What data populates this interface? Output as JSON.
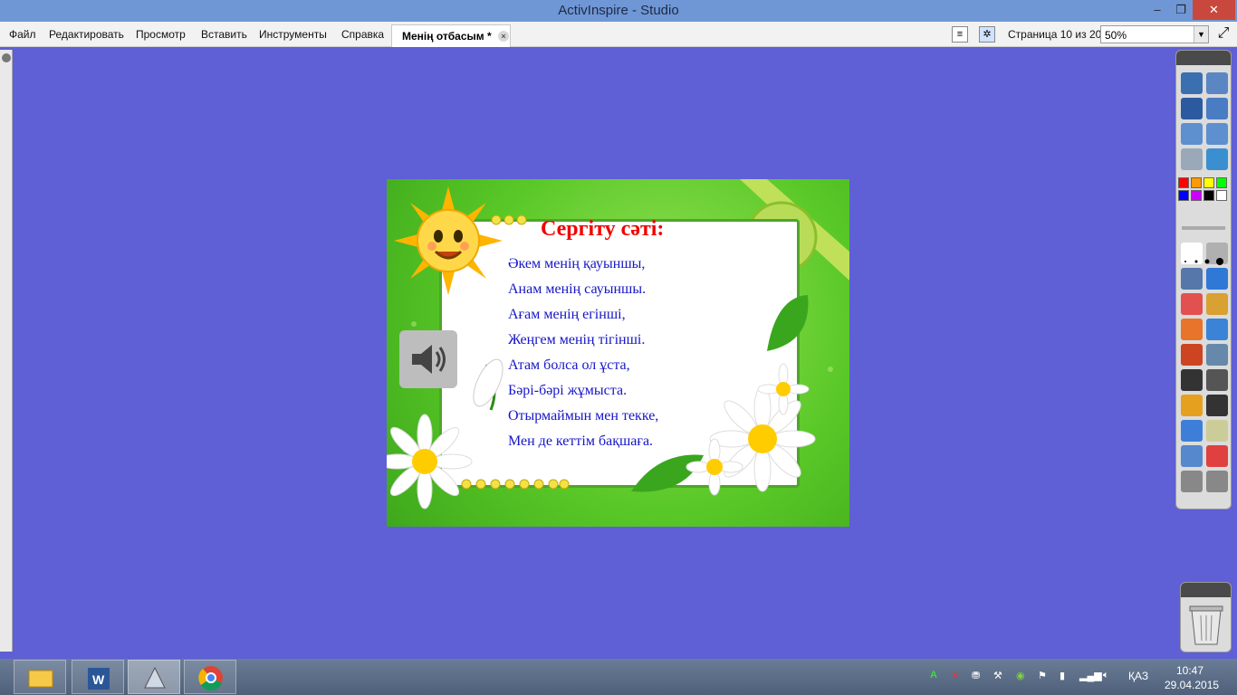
{
  "window": {
    "title": "ActivInspire - Studio",
    "min": "–",
    "max": "❐",
    "close": "✕"
  },
  "menu": [
    "Файл",
    "Редактировать",
    "Просмотр",
    "Вставить",
    "Инструменты",
    "Справка"
  ],
  "document_tab": {
    "label": "Менің отбасым *",
    "close": "×"
  },
  "page_indicator": "Страница 10 из 20",
  "zoom": {
    "value": "50%"
  },
  "slide": {
    "title": "Сергіту сәті:",
    "lines": [
      "Әкем менің қауыншы,",
      "Анам менің сауыншы.",
      "Ағам менің егінші,",
      "Жеңгем менің тігінші.",
      "Атам болса ол ұста,",
      "Бәрі-бәрі жұмыста.",
      "Отырмаймын мен текке,",
      "Мен де кеттім бақшаға."
    ],
    "background_color": "#59c827",
    "title_color": "#f20000",
    "text_color": "#1616c8"
  },
  "palette": [
    "#ff0000",
    "#ff9900",
    "#ffff00",
    "#00ff00",
    "#0000ff",
    "#cc00ff",
    "#000000",
    "#ffffff"
  ],
  "toolbox_tools": [
    "page-browser-icon",
    "resource-browser-icon",
    "pen-icon",
    "desktop-annotate-icon",
    "previous-page-icon",
    "next-page-icon",
    "play-icon",
    "refresh-icon",
    "select-icon",
    "tools-icon",
    "pen-tool-icon",
    "highlighter-icon",
    "eraser-icon",
    "fill-icon",
    "shape-icon",
    "connector-icon",
    "duplicate-icon",
    "clear-icon",
    "text-icon",
    "grid-icon",
    "spellcheck-icon",
    "reveal-icon",
    "browser-icon",
    "handwriting-icon",
    "magic-ink-icon",
    "reset-icon",
    "undo-icon",
    "redo-icon"
  ],
  "taskbar": {
    "apps": [
      "file-explorer-icon",
      "word-icon",
      "activinspire-icon",
      "chrome-icon"
    ]
  },
  "tray": {
    "lang": "ҚАЗ",
    "time": "10:47",
    "date": "29.04.2015"
  }
}
